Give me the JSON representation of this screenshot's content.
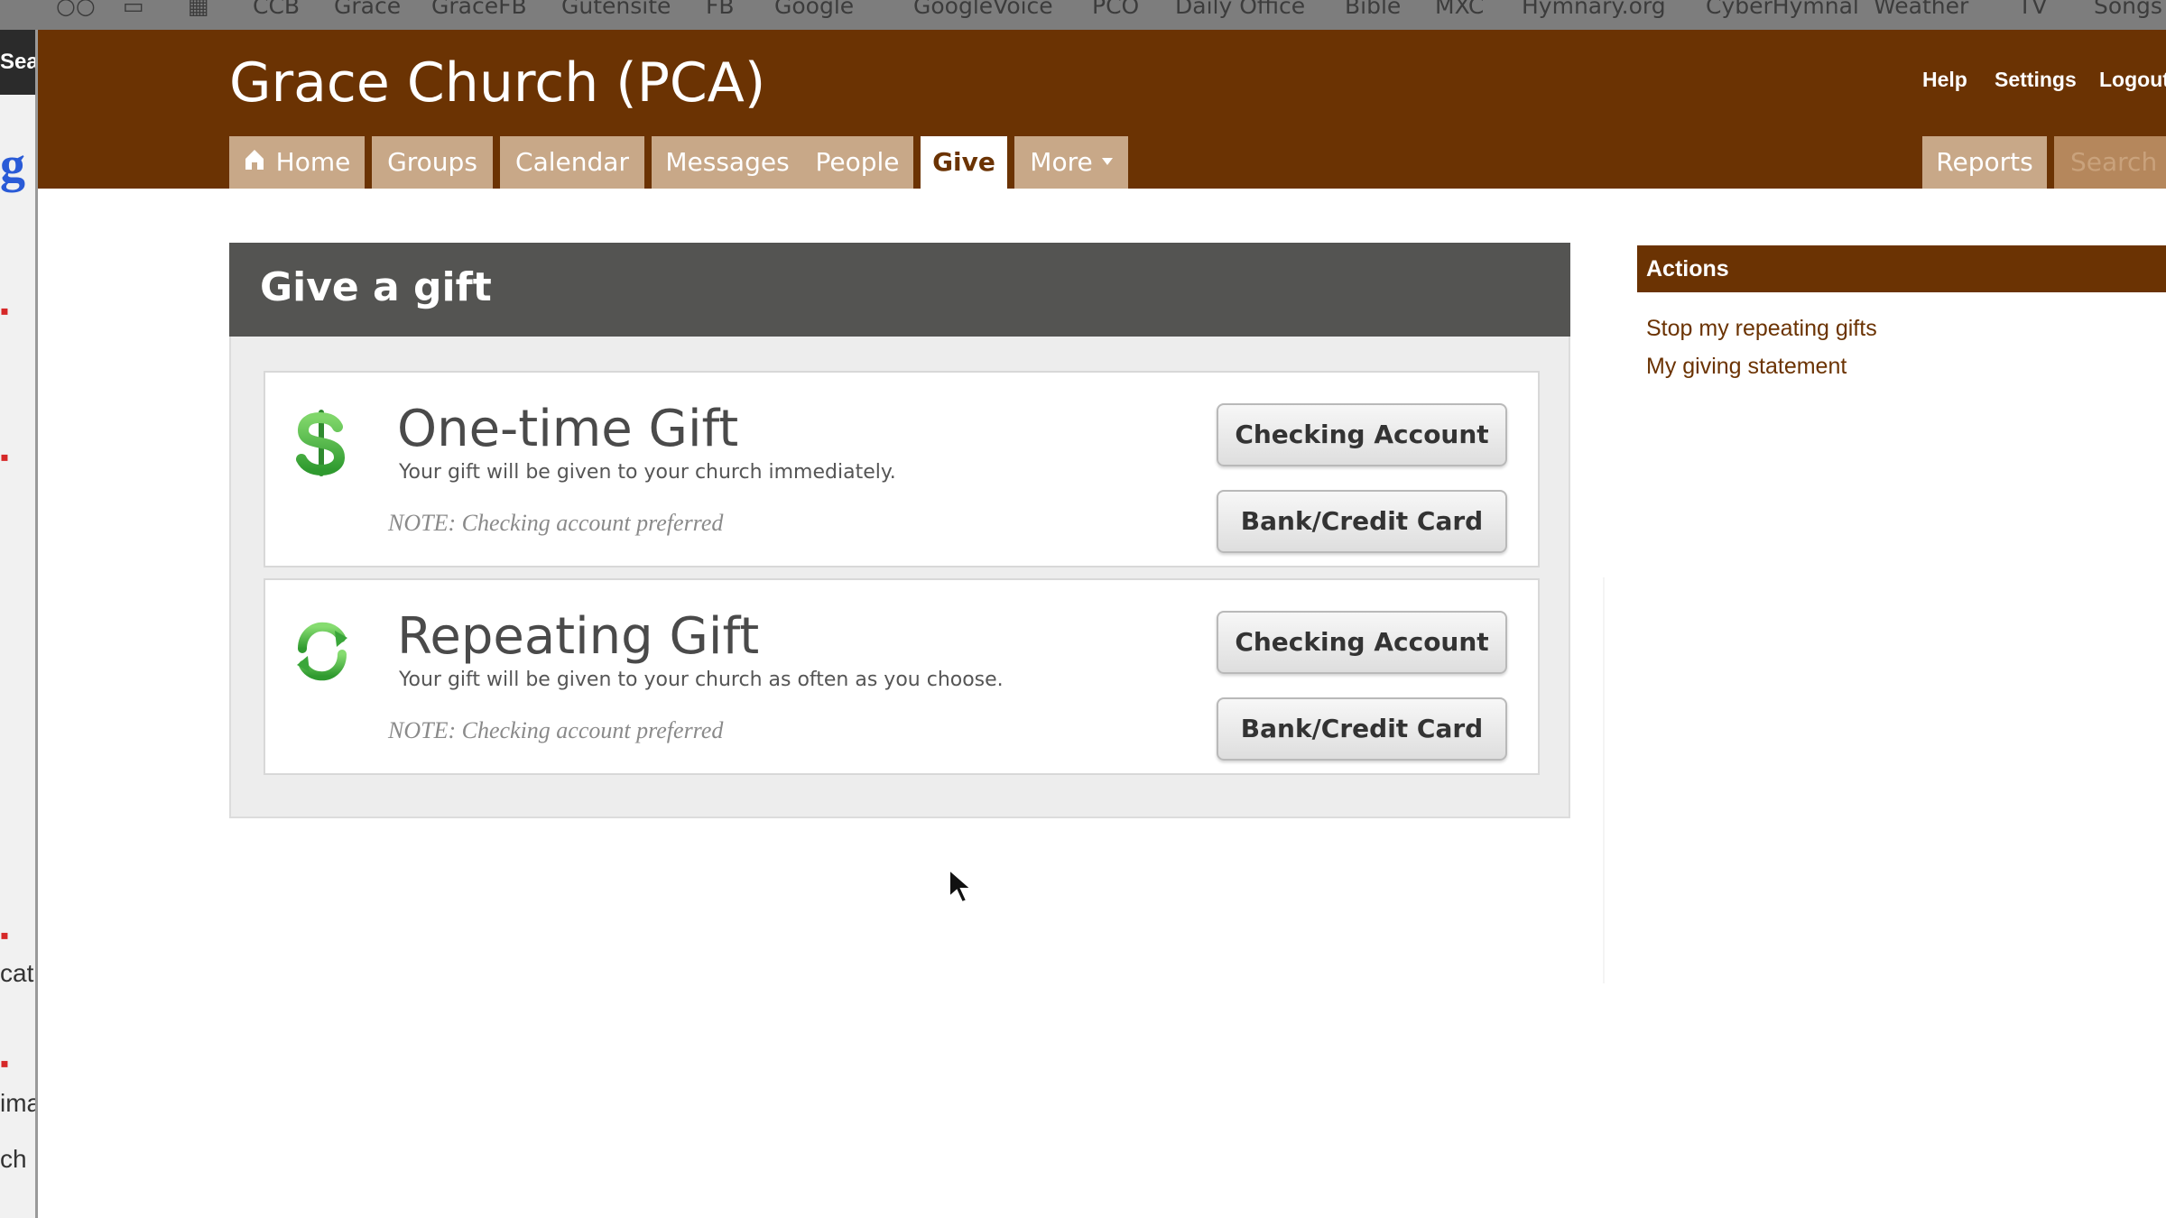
{
  "bookmarks": [
    "CCB",
    "Grace",
    "GraceFB",
    "Gutensite",
    "FB",
    "Google",
    "GoogleVoice",
    "PCO",
    "Daily Office",
    "Bible",
    "MXC",
    "Hymnary.org",
    "CyberHymnal",
    "Weather",
    "TV",
    "Songs"
  ],
  "left_sidebar": {
    "top_text": "Sea",
    "google_letter": "g",
    "fragments": [
      "cat",
      "ima",
      "ch"
    ]
  },
  "header": {
    "title": "Grace Church (PCA)",
    "utility_links": [
      "Help",
      "Settings",
      "Logout"
    ],
    "tabs": [
      {
        "label": "Home",
        "icon": "home-icon"
      },
      {
        "label": "Groups"
      },
      {
        "label": "Calendar"
      },
      {
        "label": "Messages"
      },
      {
        "label": "People"
      },
      {
        "label": "Give",
        "active": true
      },
      {
        "label": "More"
      }
    ],
    "reports_label": "Reports",
    "search_placeholder": "Search",
    "brand_color": "#6b3303"
  },
  "give_panel": {
    "title": "Give a gift",
    "gifts": [
      {
        "icon": "dollar-icon",
        "title": "One-time Gift",
        "description": "Your gift will be given to your church immediately.",
        "note": "NOTE: Checking account preferred",
        "buttons": [
          "Checking Account",
          "Bank/Credit Card"
        ]
      },
      {
        "icon": "repeat-icon",
        "title": "Repeating Gift",
        "description": "Your gift will be given to your church as often as you choose.",
        "note": "NOTE: Checking account preferred",
        "buttons": [
          "Checking Account",
          "Bank/Credit Card"
        ]
      }
    ]
  },
  "actions": {
    "title": "Actions",
    "links": [
      "Stop my repeating gifts",
      "My giving statement"
    ]
  }
}
